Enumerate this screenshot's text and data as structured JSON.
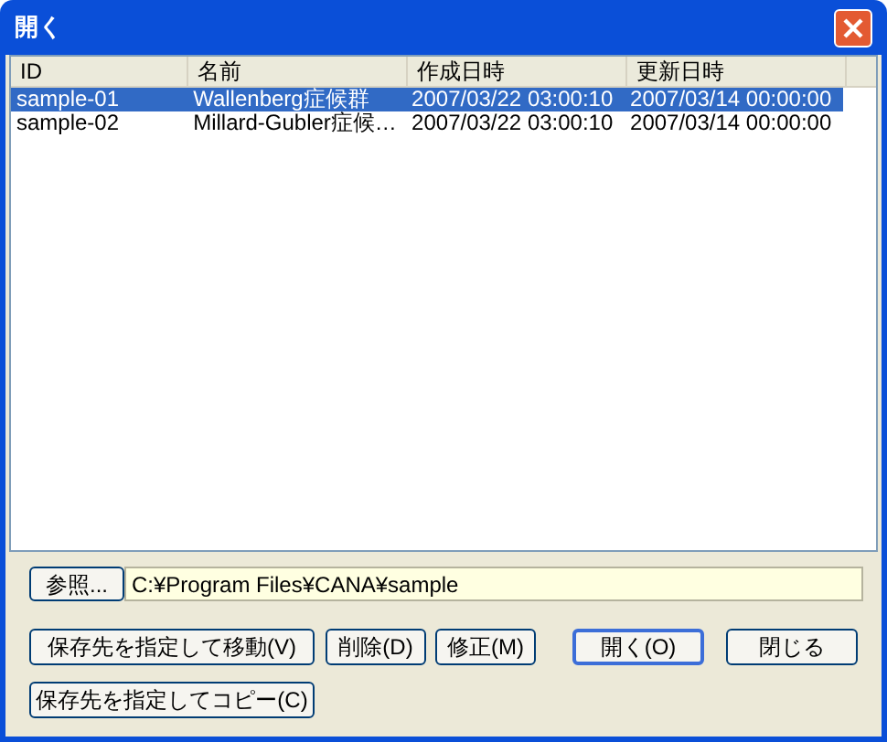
{
  "window": {
    "title": "開く"
  },
  "table": {
    "columns": [
      "ID",
      "名前",
      "作成日時",
      "更新日時"
    ],
    "rows": [
      {
        "cells": [
          "sample-01",
          "Wallenberg症候群",
          "2007/03/22 03:00:10",
          "2007/03/14 00:00:00"
        ],
        "selected": true
      },
      {
        "cells": [
          "sample-02",
          "Millard-Gubler症候…",
          "2007/03/22 03:00:10",
          "2007/03/14 00:00:00"
        ],
        "selected": false
      }
    ]
  },
  "browse_button": "参照...",
  "path_field": {
    "value": "C:¥Program Files¥CANA¥sample"
  },
  "buttons": [
    {
      "label": "保存先を指定して移動(V)",
      "default": false
    },
    {
      "label": "削除(D)",
      "default": false
    },
    {
      "label": "修正(M)",
      "default": false
    },
    {
      "label": "開く(O)",
      "default": true
    },
    {
      "label": "閉じる",
      "default": false
    },
    {
      "label": "保存先を指定してコピー(C)",
      "default": false
    }
  ]
}
